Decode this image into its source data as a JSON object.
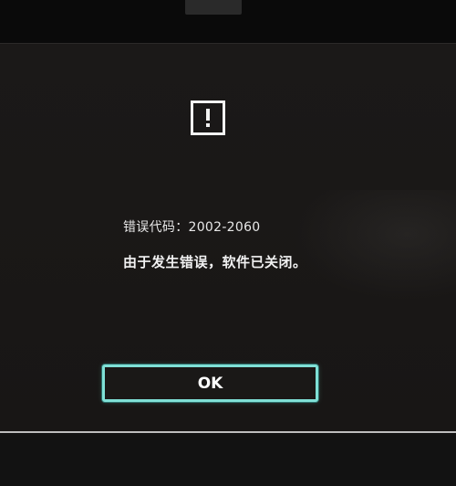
{
  "dialog": {
    "icon": "exclamation-icon",
    "error_code_label": "错误代码：2002-2060",
    "message": "由于发生错误，软件已关闭。",
    "ok_label": "OK"
  },
  "colors": {
    "background": "#1a1817",
    "text": "#f2f2f2",
    "button_border": "#7fe0d6"
  }
}
